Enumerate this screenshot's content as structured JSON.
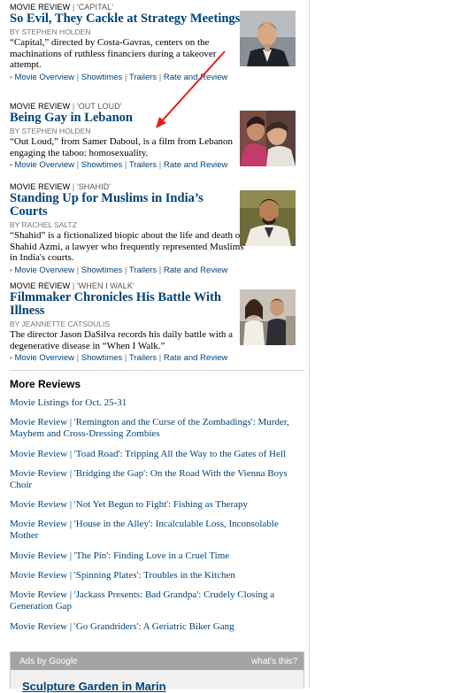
{
  "reviews": [
    {
      "kicker": "Movie Review",
      "tag": "'Capital'",
      "headline": "So Evil, They Cackle at Strategy Meetings",
      "byline": "By Stephen Holden",
      "summary": "“Capital,” directed by Costa-Gavras, centers on the machinations of ruthless financiers during a takeover attempt.",
      "links": [
        "Movie Overview",
        "Showtimes",
        "Trailers",
        "Rate and Review"
      ]
    },
    {
      "kicker": "Movie Review",
      "tag": "'Out Loud'",
      "headline": "Being Gay in Lebanon",
      "byline": "By Stephen Holden",
      "summary": "“Out Loud,” from Samer Daboul, is a film from Lebanon engaging the taboo: homosexuality.",
      "links": [
        "Movie Overview",
        "Showtimes",
        "Trailers",
        "Rate and Review"
      ]
    },
    {
      "kicker": "Movie Review",
      "tag": "'Shahid'",
      "headline": "Standing Up for Muslims in India’s Courts",
      "byline": "By Rachel Saltz",
      "summary": "“Shahid” is a fictionalized biopic about the life and death of Shahid Azmi, a lawyer who frequently represented Muslims in India's courts.",
      "links": [
        "Movie Overview",
        "Showtimes",
        "Trailers",
        "Rate and Review"
      ]
    },
    {
      "kicker": "Movie Review",
      "tag": "'When I Walk'",
      "headline": "Filmmaker Chronicles His Battle With Illness",
      "byline": "By Jeannette Catsoulis",
      "summary": "The director Jason DaSilva records his daily battle with a degenerative disease in “When I Walk.”",
      "links": [
        "Movie Overview",
        "Showtimes",
        "Trailers",
        "Rate and Review"
      ]
    }
  ],
  "more_reviews": {
    "title": "More Reviews",
    "items": [
      "Movie Listings for Oct. 25-31",
      "Movie Review | 'Remington and the Curse of the Zombadings': Murder, Mayhem and Cross-Dressing Zombies",
      "Movie Review | 'Toad Road': Tripping All the Way to the Gates of Hell",
      "Movie Review | 'Bridging the Gap': On the Road With the Vienna Boys Choir",
      "Movie Review | 'Not Yet Begun to Fight': Fishing as Therapy",
      "Movie Review | 'House in the Alley': Incalculable Loss, Inconsolable Mother",
      "Movie Review | 'The Pin': Finding Love in a Cruel Time",
      "Movie Review | 'Spinning Plates': Troubles in the Kitchen",
      "Movie Review | 'Jackass Presents: Bad Grandpa': Crudely Closing a Generation Gap",
      "Movie Review | 'Go Grandriders': A Geriatric Biker Gang"
    ]
  },
  "ads": {
    "label": "Ads by Google",
    "whats_this": "what's this?",
    "ad_title": "Sculpture Garden in Marin"
  },
  "colors": {
    "link": "#004276",
    "annotation_arrow": "#e0201c"
  }
}
